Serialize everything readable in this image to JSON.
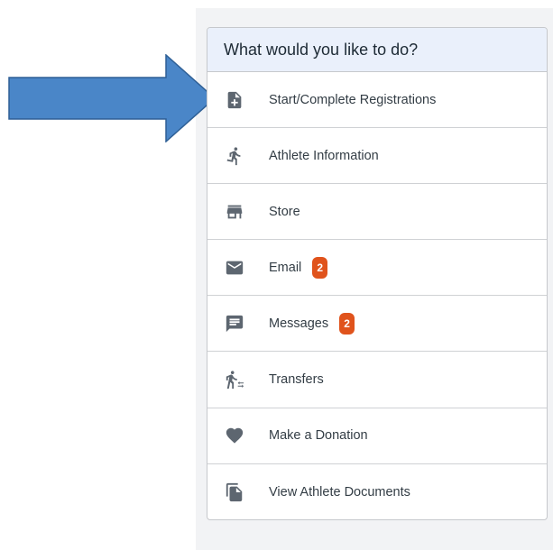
{
  "panel": {
    "title": "What would you like to do?",
    "icon_color": "#5d6670",
    "badge_color": "#e0531c",
    "header_bg": "#eaf0fb",
    "items": [
      {
        "label": "Start/Complete Registrations",
        "icon": "document-add-icon"
      },
      {
        "label": "Athlete Information",
        "icon": "running-person-icon"
      },
      {
        "label": "Store",
        "icon": "storefront-icon"
      },
      {
        "label": "Email",
        "icon": "envelope-icon",
        "badge": "2"
      },
      {
        "label": "Messages",
        "icon": "message-bubble-icon",
        "badge": "2"
      },
      {
        "label": "Transfers",
        "icon": "walking-transfer-icon"
      },
      {
        "label": "Make a Donation",
        "icon": "heart-icon"
      },
      {
        "label": "View Athlete Documents",
        "icon": "documents-icon"
      }
    ]
  },
  "annotation": {
    "arrow_color": "#4a86c8",
    "arrow_target": "Start/Complete Registrations"
  }
}
